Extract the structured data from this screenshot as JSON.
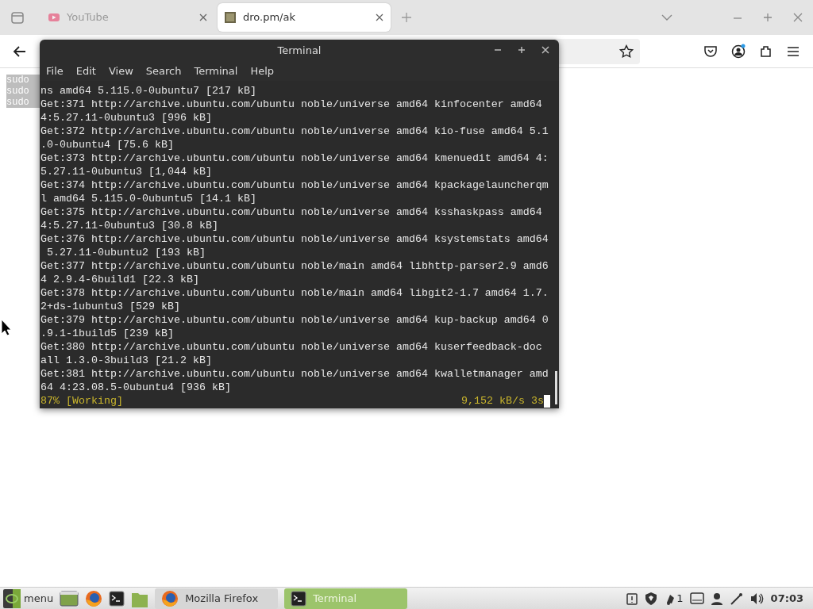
{
  "browser": {
    "tabs": [
      {
        "title": "YouTube",
        "selected": false
      },
      {
        "title": "dro.pm/ak",
        "selected": true
      }
    ],
    "page_lines": [
      "sudo",
      "sudo",
      "sudo"
    ]
  },
  "terminal": {
    "title": "Terminal",
    "menu": [
      "File",
      "Edit",
      "View",
      "Search",
      "Terminal",
      "Help"
    ],
    "lines": [
      "ns amd64 5.115.0-0ubuntu7 [217 kB]",
      "Get:371 http://archive.ubuntu.com/ubuntu noble/universe amd64 kinfocenter amd64",
      "4:5.27.11-0ubuntu3 [996 kB]",
      "Get:372 http://archive.ubuntu.com/ubuntu noble/universe amd64 kio-fuse amd64 5.1",
      ".0-0ubuntu4 [75.6 kB]",
      "Get:373 http://archive.ubuntu.com/ubuntu noble/universe amd64 kmenuedit amd64 4:",
      "5.27.11-0ubuntu3 [1,044 kB]",
      "Get:374 http://archive.ubuntu.com/ubuntu noble/universe amd64 kpackagelauncherqm",
      "l amd64 5.115.0-0ubuntu5 [14.1 kB]",
      "Get:375 http://archive.ubuntu.com/ubuntu noble/universe amd64 ksshaskpass amd64",
      "4:5.27.11-0ubuntu3 [30.8 kB]",
      "Get:376 http://archive.ubuntu.com/ubuntu noble/universe amd64 ksystemstats amd64",
      " 5.27.11-0ubuntu2 [193 kB]",
      "Get:377 http://archive.ubuntu.com/ubuntu noble/main amd64 libhttp-parser2.9 amd6",
      "4 2.9.4-6build1 [22.3 kB]",
      "Get:378 http://archive.ubuntu.com/ubuntu noble/main amd64 libgit2-1.7 amd64 1.7.",
      "2+ds-1ubuntu3 [529 kB]",
      "Get:379 http://archive.ubuntu.com/ubuntu noble/universe amd64 kup-backup amd64 0",
      ".9.1-1build5 [239 kB]",
      "Get:380 http://archive.ubuntu.com/ubuntu noble/universe amd64 kuserfeedback-doc",
      "all 1.3.0-3build3 [21.2 kB]",
      "Get:381 http://archive.ubuntu.com/ubuntu noble/universe amd64 kwalletmanager amd",
      "64 4:23.08.5-0ubuntu4 [936 kB]"
    ],
    "status_left": "87% [Working]",
    "status_right": "9,152 kB/s 3s"
  },
  "taskbar": {
    "menu_label": "menu",
    "windows": [
      {
        "label": "Mozilla Firefox",
        "kind": "firefox",
        "selected": false
      },
      {
        "label": "Terminal",
        "kind": "terminal",
        "selected": true
      }
    ],
    "notification_count": "1",
    "clock": "07:03"
  }
}
